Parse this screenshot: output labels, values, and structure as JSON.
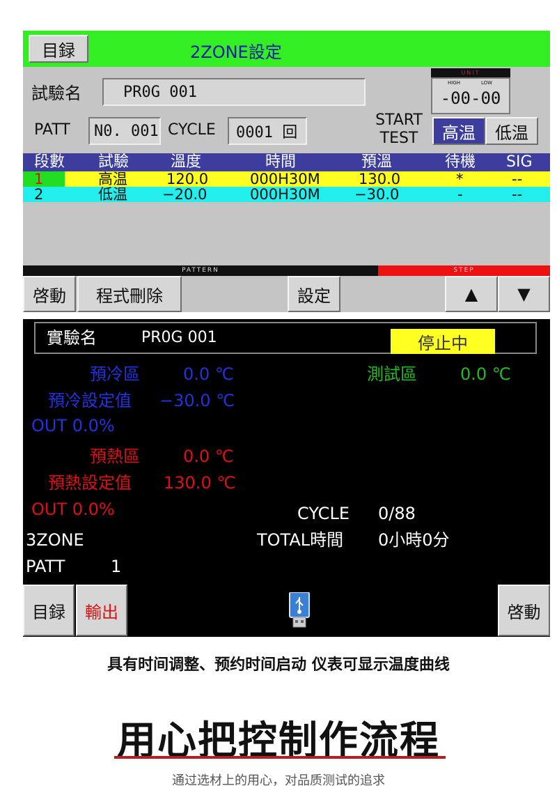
{
  "panel1": {
    "menu_button": "目録",
    "title": "2ZONE設定",
    "test_name_label": "試驗名",
    "test_name_value": "PR0G 001",
    "unit": {
      "header": "UNIT",
      "high_label": "HIGH",
      "low_label": "LOW",
      "value": "-00-00"
    },
    "patt_label": "PATT",
    "patt_value": "N0. 001",
    "cycle_label": "CYCLE",
    "cycle_value": "0001 回",
    "start_test": [
      "START",
      "TEST"
    ],
    "high_temp_btn": "高温",
    "low_temp_btn": "低温",
    "columns": [
      "段數",
      "試驗",
      "溫度",
      "時間",
      "預溫",
      "待機",
      "SIG"
    ],
    "rows": [
      [
        "1",
        "高温",
        "120.0",
        "000H30M",
        "130.0",
        "*",
        "--"
      ],
      [
        "2",
        "低温",
        "−20.0",
        "000H30M",
        "−30.0",
        "-",
        "--"
      ]
    ],
    "pattern_bar": "PATTERN",
    "step_bar": "STEP",
    "buttons": {
      "start": "啓動",
      "delete": "程式刪除",
      "set": "設定",
      "up": "▲",
      "down": "▼"
    }
  },
  "panel2": {
    "test_label": "實驗名",
    "test_value": "PR0G 001",
    "status": "停止中",
    "precool_zone_label": "預冷區",
    "precool_zone_value": "0.0 ℃",
    "test_zone_label": "測試區",
    "test_zone_value": "0.0 ℃",
    "precool_set_label": "預冷設定值",
    "precool_set_value": "−30.0 ℃",
    "out1": "OUT 0.0%",
    "preheat_zone_label": "預熱區",
    "preheat_zone_value": "0.0 ℃",
    "preheat_set_label": "預熱設定值",
    "preheat_set_value": "130.0 ℃",
    "out2": "OUT 0.0%",
    "cycle_label": "CYCLE",
    "cycle_value": "0/88",
    "zone_label": "3ZONE",
    "total_time_label": "TOTAL時間",
    "total_time_value": "0小時0分",
    "patt_label": "PATT",
    "patt_value": "1",
    "menu_button": "目録",
    "output_button": "輸出",
    "start_button": "啓動"
  },
  "caption": "具有时间调整、预约时间启动 仪表可显示温度曲线",
  "headline": "用心把控制作流程",
  "subheadline": "通过选材上的用心，对品质测试的追求",
  "colors": {
    "header_green": "#33ee22",
    "table_header": "#3d3d9e",
    "row1": "#ffff22",
    "row2": "#22eeee",
    "step_red": "#ee1111",
    "status_yellow": "#ffff22",
    "accent_red": "#b61f1f"
  }
}
